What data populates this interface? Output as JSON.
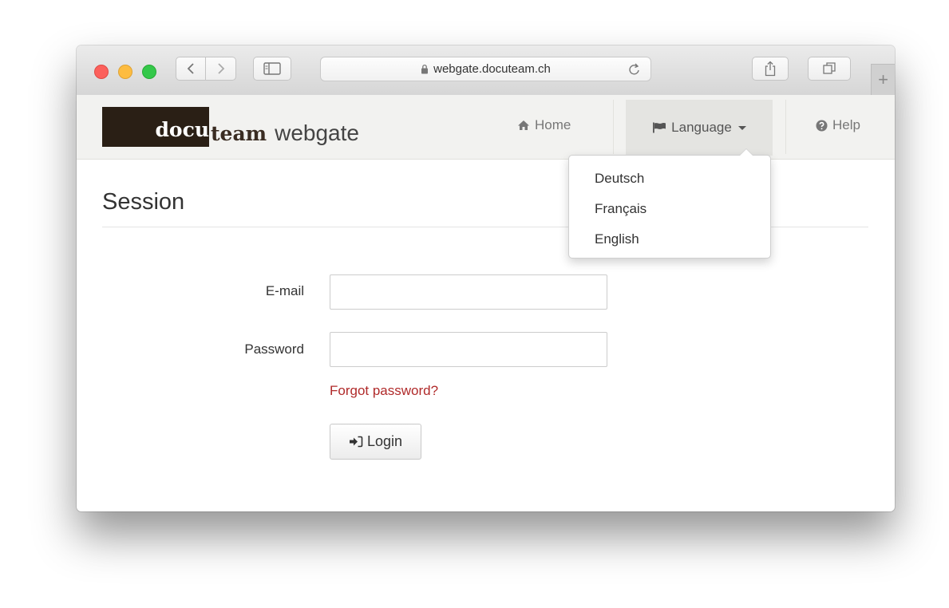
{
  "browser": {
    "url": "webgate.docuteam.ch",
    "new_tab_label": "+"
  },
  "navbar": {
    "logo": {
      "part1": "docu",
      "part2": "team",
      "part3": "webgate"
    },
    "home_label": "Home",
    "language_label": "Language",
    "help_label": "Help",
    "language_menu": [
      "Deutsch",
      "Français",
      "English"
    ]
  },
  "page": {
    "title": "Session",
    "email_label": "E-mail",
    "email_value": "",
    "password_label": "Password",
    "password_value": "",
    "forgot_label": "Forgot password?",
    "login_label": "Login"
  },
  "colors": {
    "link": "#b02a2a",
    "logo_bg": "#2a1f15",
    "navbar_bg": "#f2f2f0"
  },
  "icons": [
    "back-icon",
    "forward-icon",
    "sidebar-icon",
    "lock-icon",
    "reload-icon",
    "share-icon",
    "tabs-icon",
    "home-icon",
    "flag-icon",
    "help-icon",
    "login-icon"
  ]
}
